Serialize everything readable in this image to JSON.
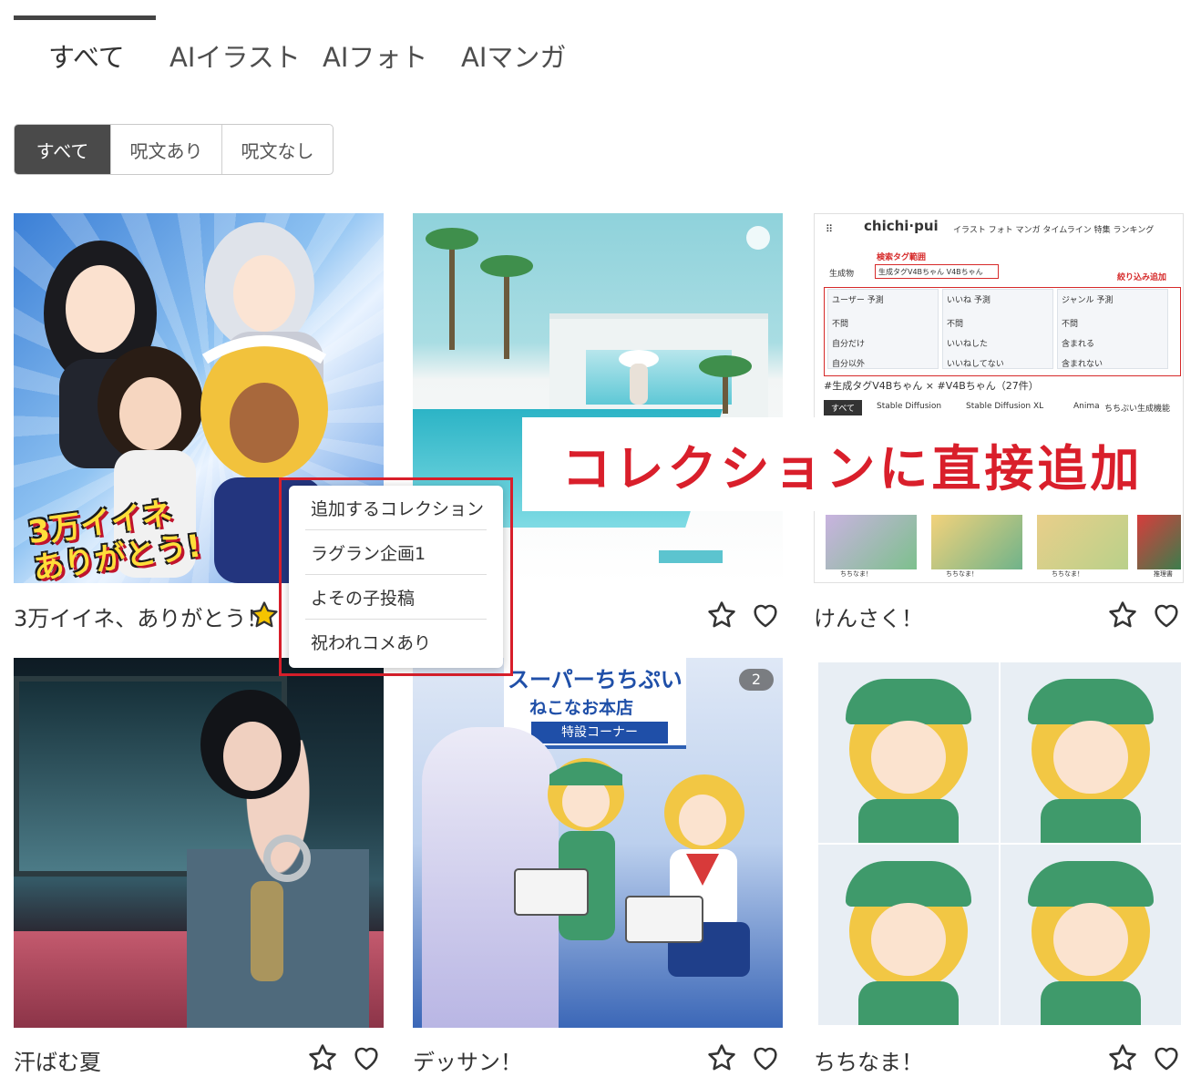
{
  "tabs": [
    "すべて",
    "AIイラスト",
    "AIフォト",
    "AIマンガ"
  ],
  "filters": [
    "すべて",
    "呪文あり",
    "呪文なし"
  ],
  "cards": [
    {
      "title": "3万イイネ、ありがとう！",
      "poster_text": "3万イイネありがとう!",
      "starred": true
    },
    {
      "title": "",
      "starred": false
    },
    {
      "title": "けんさく！",
      "starred": false
    },
    {
      "title": "汗ばむ夏",
      "starred": false
    },
    {
      "title": "デッサン！",
      "starred": false,
      "image_count": "2",
      "sign_title": "スーパーちちぷい",
      "sign_sub": "ねこなお本店",
      "banner": "特設コーナー"
    },
    {
      "title": "ちちなま！",
      "starred": false
    }
  ],
  "screenshot_thumb": {
    "logo": "chichi·pui",
    "nav": "イラスト  フォト  マンガ  タイムライン  特集  ランキング",
    "tag_label": "検索タグ範囲",
    "scope": "生成物",
    "query": "生成タグV4Bちゃん V4Bちゃん",
    "filter_label": "絞り込み追加",
    "columns": [
      {
        "head": "ユーザー 予測",
        "options": [
          "不問",
          "自分だけ",
          "自分以外"
        ]
      },
      {
        "head": "いいね 予測",
        "options": [
          "不問",
          "いいねした",
          "いいねしてない"
        ]
      },
      {
        "head": "ジャンル 予測",
        "options": [
          "不問",
          "含まれる",
          "含まれない"
        ]
      }
    ],
    "result": "#生成タグV4Bちゃん × #V4Bちゃん（27件）",
    "chips": [
      "すべて",
      "Stable Diffusion",
      "Stable Diffusion XL",
      "Anima",
      "ちちぷい生成機能"
    ],
    "strip_names": [
      "ちちなま！",
      "ちちなま！",
      "ちちなま！",
      "推理書"
    ]
  },
  "callout": "コレクションに直接追加",
  "collection_menu": {
    "header": "追加するコレクション",
    "items": [
      "ラグラン企画1",
      "よその子投稿",
      "祝われコメあり"
    ]
  },
  "colors": {
    "accent_red": "#d91f2b",
    "star_active": "#f5c400",
    "icon": "#333333"
  }
}
